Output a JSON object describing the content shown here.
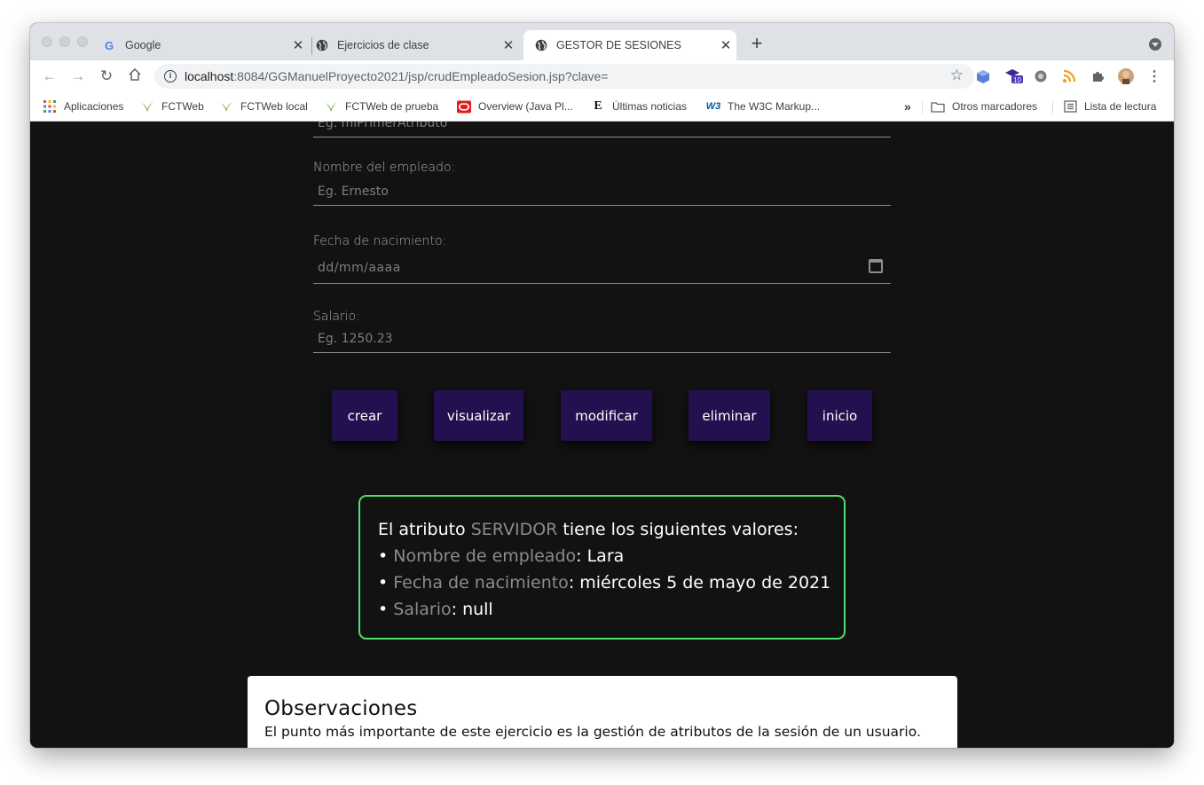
{
  "tabs": [
    {
      "title": "Google"
    },
    {
      "title": "Ejercicios de clase"
    },
    {
      "title": "GESTOR DE SESIONES"
    }
  ],
  "toolbar": {
    "url_host": "localhost",
    "url_rest": ":8084/GGManuelProyecto2021/jsp/crudEmpleadoSesion.jsp?clave=",
    "ext_badge": "10"
  },
  "bookmarks": {
    "items": [
      {
        "label": "Aplicaciones",
        "icon": "apps-grid-icon"
      },
      {
        "label": "FCTWeb",
        "icon": "leaf-icon"
      },
      {
        "label": "FCTWeb local",
        "icon": "leaf-icon"
      },
      {
        "label": "FCTWeb de prueba",
        "icon": "leaf-icon"
      },
      {
        "label": "Overview (Java Pl...",
        "icon": "oracle-icon"
      },
      {
        "label": "Últimas noticias",
        "icon": "news-icon"
      },
      {
        "label": "The W3C Markup...",
        "icon": "w3c-icon"
      }
    ],
    "more": "»",
    "other": "Otros marcadores",
    "reading": "Lista de lectura"
  },
  "form": {
    "cut_placeholder": "Eg. miPrimerAtributo",
    "name_label": "Nombre del empleado:",
    "name_placeholder": "Eg. Ernesto",
    "date_label": "Fecha de nacimiento:",
    "date_placeholder": "dd/mm/aaaa",
    "salary_label": "Salario:",
    "salary_placeholder": "Eg. 1250.23"
  },
  "buttons": {
    "create": "crear",
    "view": "visualizar",
    "modify": "modificar",
    "delete": "eliminar",
    "home": "inicio"
  },
  "result": {
    "intro_pre": "El atributo ",
    "attr": "SERVIDOR",
    "intro_post": " tiene los siguientes valores:",
    "bullet": "•",
    "rows": [
      {
        "key": "Nombre de empleado",
        "sep": ": ",
        "value": "Lara"
      },
      {
        "key": "Fecha de nacimiento",
        "sep": ": ",
        "value": "miércoles 5 de mayo de 2021"
      },
      {
        "key": "Salario",
        "sep": ": ",
        "value": "null"
      }
    ]
  },
  "observaciones": {
    "title": "Observaciones",
    "text": "El punto más importante de este ejercicio es la gestión de atributos de la sesión de un usuario."
  },
  "colors": {
    "page_bg": "#121212",
    "button_bg": "#23114f",
    "result_border": "#4fe06a"
  }
}
